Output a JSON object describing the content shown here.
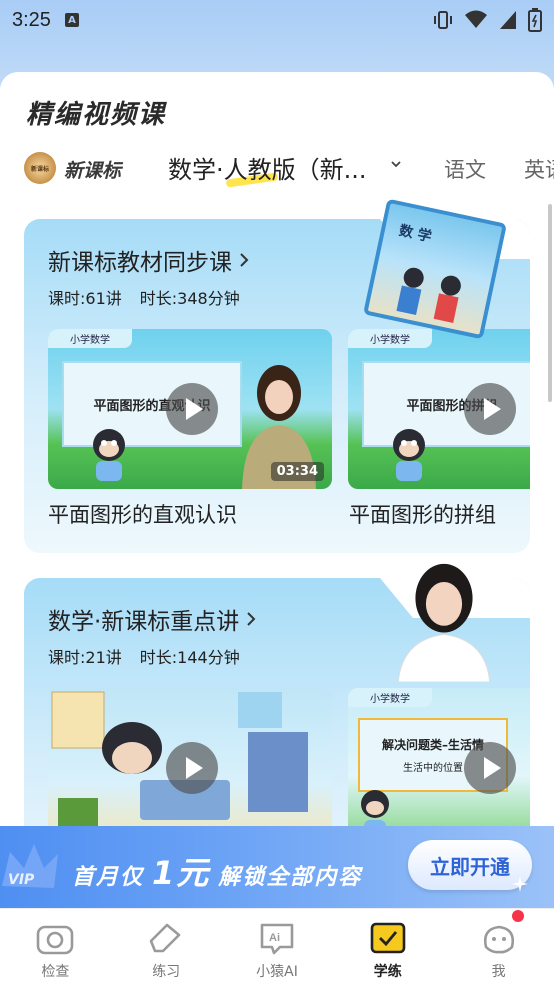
{
  "status": {
    "time": "3:25",
    "notif_icon": "A"
  },
  "page": {
    "title": "精编视频课"
  },
  "tabs": {
    "badge": "新课标",
    "items": [
      "新课标",
      "数学·人教版（新...",
      "语文",
      "英语"
    ],
    "active_index": 1
  },
  "cards": [
    {
      "title": "新课标教材同步课",
      "lessons": "课时:61讲",
      "duration": "时长:348分钟",
      "book_label": "数 学",
      "videos": [
        {
          "subject_chip": "小学数学",
          "board_text": "平面图形的直观认识",
          "duration": "03:34",
          "title": "平面图形的直观认识"
        },
        {
          "subject_chip": "小学数学",
          "board_text": "平面图形的拼组",
          "duration": "",
          "title": "平面图形的拼组"
        }
      ]
    },
    {
      "title": "数学·新课标重点讲",
      "lessons": "课时:21讲",
      "duration": "时长:144分钟",
      "videos": [
        {
          "subject_chip": "",
          "board_text": "",
          "duration": "",
          "title": ""
        },
        {
          "subject_chip": "小学数学",
          "board_text": "解决问题类–生活情",
          "sub_text": "生活中的位置",
          "duration": "",
          "title": ""
        }
      ]
    }
  ],
  "vip": {
    "badge": "VIP",
    "text_a": "首月仅",
    "text_b": "1元",
    "text_c": "解锁全部内容",
    "button": "立即开通"
  },
  "nav": {
    "items": [
      {
        "label": "检查",
        "icon": "camera-icon"
      },
      {
        "label": "练习",
        "icon": "pencil-icon"
      },
      {
        "label": "小猿AI",
        "icon": "ai-chat-icon"
      },
      {
        "label": "学练",
        "icon": "check-box-icon"
      },
      {
        "label": "我",
        "icon": "profile-face-icon"
      }
    ],
    "active_index": 3
  },
  "colors": {
    "accent_blue": "#4f8ff2",
    "highlight_yellow": "#ffe44c",
    "badge_red": "#f5344a"
  }
}
